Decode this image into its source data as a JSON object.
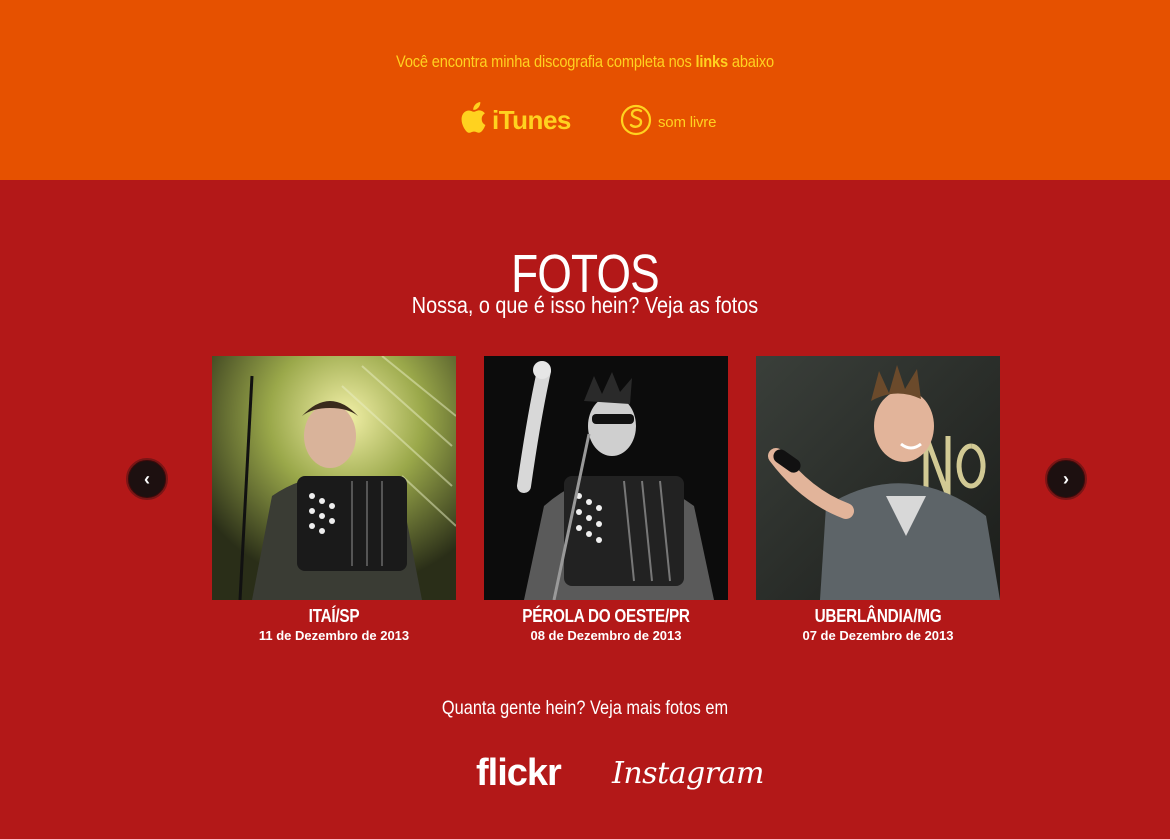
{
  "discography": {
    "text_before": "Você encontra minha discografia completa nos ",
    "text_bold": "links",
    "text_after": " abaixo",
    "itunes_label": "iTunes",
    "somlivre_label": "som livre"
  },
  "photos_section": {
    "title": "FOTOS",
    "subtitle": "Nossa, o que é isso hein?  Veja as fotos",
    "prev_label": "‹",
    "next_label": "›",
    "cards": [
      {
        "city": "ITAÍ/SP",
        "date": "11 de Dezembro de 2013"
      },
      {
        "city": "PÉROLA DO OESTE/PR",
        "date": "08 de Dezembro de 2013"
      },
      {
        "city": "UBERLÂNDIA/MG",
        "date": "07 de Dezembro de 2013"
      }
    ]
  },
  "more_photos": {
    "text": "Quanta gente hein? Veja mais fotos em",
    "flickr_label": "flickr",
    "instagram_label": "Instagram"
  },
  "colors": {
    "top_band": "#e65100",
    "main_bg": "#b31818",
    "accent_yellow": "#ffd21f",
    "text_white": "#ffffff"
  },
  "icons": [
    "apple-icon",
    "som-livre-icon",
    "chevron-left-icon",
    "chevron-right-icon"
  ]
}
